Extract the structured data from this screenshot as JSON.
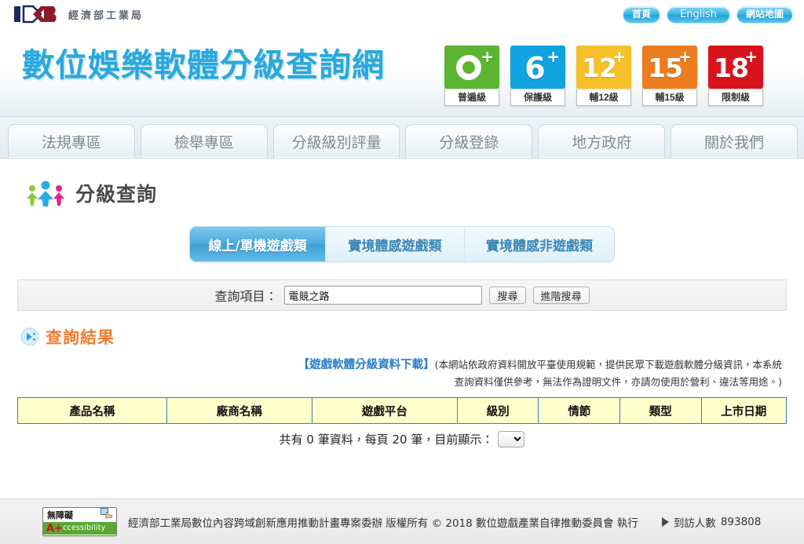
{
  "header": {
    "logo": {
      "mark": "idb-logo",
      "agency": "經濟部工業局"
    },
    "top_links": [
      {
        "label": "首頁",
        "name": "home"
      },
      {
        "label": "English",
        "name": "english"
      },
      {
        "label": "網站地圖",
        "name": "sitemap"
      }
    ],
    "site_title": "數位娛樂軟體分級查詢網",
    "rating_badges": [
      {
        "symbol": "O",
        "plus": "+",
        "caption": "普遍級",
        "color": "#5cb531",
        "type": "ring"
      },
      {
        "symbol": "6",
        "plus": "+",
        "caption": "保護級",
        "color": "#11a2e0",
        "type": "num"
      },
      {
        "symbol": "12",
        "plus": "+",
        "caption": "輔12級",
        "color": "#f7c028",
        "type": "num"
      },
      {
        "symbol": "15",
        "plus": "+",
        "caption": "輔15級",
        "color": "#ec7d1e",
        "type": "num"
      },
      {
        "symbol": "18",
        "plus": "+",
        "caption": "限制級",
        "color": "#d9131c",
        "type": "num"
      }
    ]
  },
  "nav": {
    "items": [
      {
        "label": "法規專區",
        "name": "regulations"
      },
      {
        "label": "檢舉專區",
        "name": "report"
      },
      {
        "label": "分級級別評量",
        "name": "rating-assessment"
      },
      {
        "label": "分級登錄",
        "name": "rating-registration"
      },
      {
        "label": "地方政府",
        "name": "local-government"
      },
      {
        "label": "關於我們",
        "name": "about-us"
      }
    ]
  },
  "main": {
    "section_title": "分級查詢",
    "tabs": [
      {
        "label": "線上/單機遊戲類",
        "active": true
      },
      {
        "label": "實境體感遊戲類",
        "active": false
      },
      {
        "label": "實境體感非遊戲類",
        "active": false
      }
    ],
    "search": {
      "label": "查詢項目：",
      "value": "電競之路",
      "placeholder": "",
      "search_button": "搜尋",
      "advanced_button": "進階搜尋"
    },
    "result_title": "查詢結果",
    "notice": {
      "link": "【遊戲軟體分級資料下載】",
      "line1": "(本網站依政府資料開放平臺使用規範，提供民眾下載遊戲軟體分級資訊，本系統",
      "line2": "查詢資料僅供參考，無法作為證明文件，亦請勿使用於營利、違法等用途。)"
    },
    "table": {
      "columns": [
        "產品名稱",
        "廠商名稱",
        "遊戲平台",
        "級別",
        "情節",
        "類型",
        "上市日期"
      ],
      "rows": []
    },
    "pager": {
      "text": "共有 0 筆資料，每頁 20 筆，目前顯示：",
      "selected": "",
      "options": [
        ""
      ]
    }
  },
  "footer": {
    "a11y_badge": {
      "top": "無障礙",
      "mark_red": "A+",
      "mark_rest": "ccessibility"
    },
    "text": "經濟部工業局數位內容跨域創新應用推動計畫專案委辦   版權所有 © 2018 數位遊戲產業自律推動委員會 執行",
    "visits_label": "到訪人數",
    "visits_count": "893808"
  },
  "colors": {
    "brand_blue": "#2aa8dd",
    "accent_orange": "#ef7c2f",
    "table_header_bg": "#ffffcc",
    "table_border": "#3b7fb8"
  }
}
